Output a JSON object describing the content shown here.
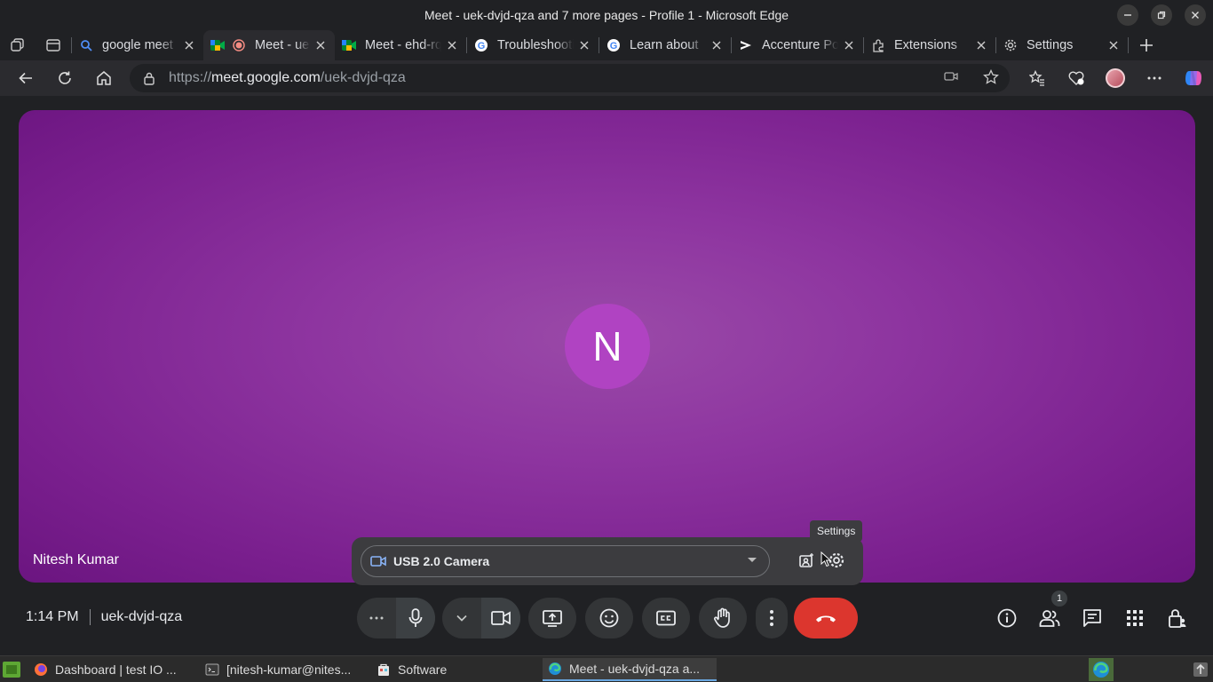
{
  "window": {
    "title": "Meet - uek-dvjd-qza and 7 more pages - Profile 1 - Microsoft Edge"
  },
  "tabs": [
    {
      "label": "google meet",
      "favicon": "search-icon"
    },
    {
      "label": "Meet - uek-dvjd-qza",
      "favicon": "meet-icon",
      "active": true,
      "recording": true
    },
    {
      "label": "Meet - ehd-rqxz",
      "favicon": "meet-icon"
    },
    {
      "label": "Troubleshooting",
      "favicon": "google-icon"
    },
    {
      "label": "Learn about",
      "favicon": "google-icon"
    },
    {
      "label": "Accenture Portal",
      "favicon": "accenture-icon"
    },
    {
      "label": "Extensions",
      "favicon": "extensions-icon"
    },
    {
      "label": "Settings",
      "favicon": "gear-icon"
    }
  ],
  "address": {
    "scheme": "https://",
    "host": "meet.google.com",
    "path": "/uek-dvjd-qza"
  },
  "meet": {
    "avatar_initial": "N",
    "participant_name": "Nitesh Kumar",
    "camera_device": "USB 2.0 Camera",
    "tooltip": "Settings",
    "time": "1:14 PM",
    "meeting_code": "uek-dvjd-qza",
    "people_count": "1"
  },
  "taskbar": [
    {
      "label": "Dashboard | test IO ...",
      "icon": "firefox-icon"
    },
    {
      "label": "[nitesh-kumar@nites...",
      "icon": "terminal-icon"
    },
    {
      "label": "Software",
      "icon": "software-icon"
    },
    {
      "label": "Meet - uek-dvjd-qza a...",
      "icon": "edge-icon",
      "active": true
    }
  ],
  "colors": {
    "tile": "#8e35a0",
    "avatar": "#b043c2",
    "end_call": "#dc362e",
    "control": "#333537"
  }
}
